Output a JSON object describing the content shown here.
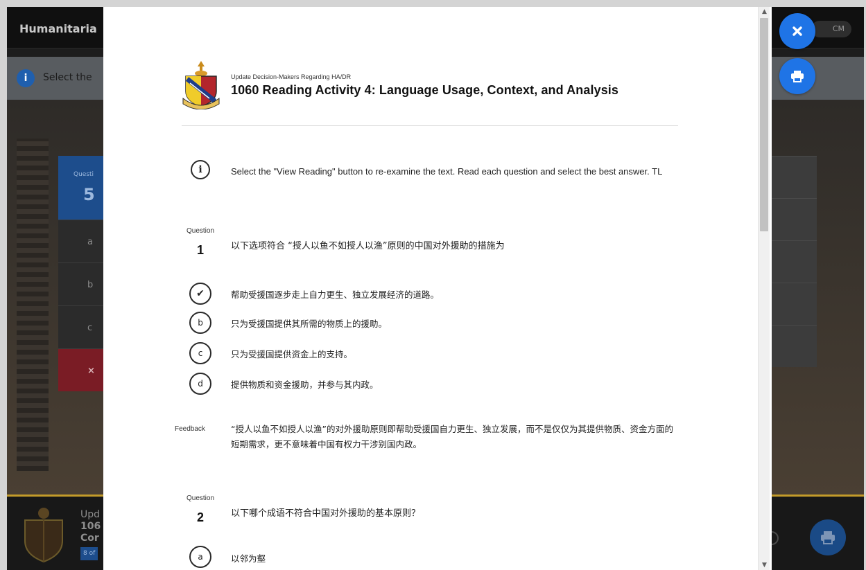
{
  "background": {
    "app_title": "Humanitaria",
    "toggle_label": "CM",
    "instruction_snippet": "Select the",
    "question_panel": {
      "label": "Questi",
      "number": "5",
      "options": [
        "a",
        "b",
        "c"
      ],
      "wrong_marker": "×"
    },
    "footer": {
      "line1": "Upd",
      "line2": "106",
      "line3": "Cor",
      "progress": "8 of"
    }
  },
  "modal": {
    "subtitle": "Update Decision-Makers Regarding HA/DR",
    "title": "1060 Reading Activity 4: Language Usage, Context, and Analysis",
    "instruction": "Select the \"View Reading\" button to re-examine the text. Read each question and select the best answer. TL",
    "questions": [
      {
        "label": "Question",
        "number": "1",
        "text": "以下选项符合 “授人以鱼不如授人以渔”原则的中国对外援助的措施为",
        "options": [
          {
            "marker": "✔",
            "text": "帮助受援国逐步走上自力更生、独立发展经济的道路。"
          },
          {
            "marker": "b",
            "text": "只为受援国提供其所需的物质上的援助。"
          },
          {
            "marker": "c",
            "text": "只为受援国提供资金上的支持。"
          },
          {
            "marker": "d",
            "text": "提供物质和资金援助，并参与其内政。"
          }
        ],
        "feedback_label": "Feedback",
        "feedback": "“授人以鱼不如授人以渔”的对外援助原则即帮助受援国自力更生、独立发展，而不是仅仅为其提供物质、资金方面的短期需求，更不意味着中国有权力干涉别国内政。"
      },
      {
        "label": "Question",
        "number": "2",
        "text": "以下哪个成语不符合中国对外援助的基本原则？",
        "options": [
          {
            "marker": "a",
            "text": "以邻为壑"
          }
        ]
      }
    ]
  },
  "buttons": {
    "close_icon": "close-icon",
    "print_icon": "print-icon"
  },
  "colors": {
    "accent": "#1f74e6",
    "wrong": "#7a1c25",
    "footer_rule": "#c39b2a"
  }
}
